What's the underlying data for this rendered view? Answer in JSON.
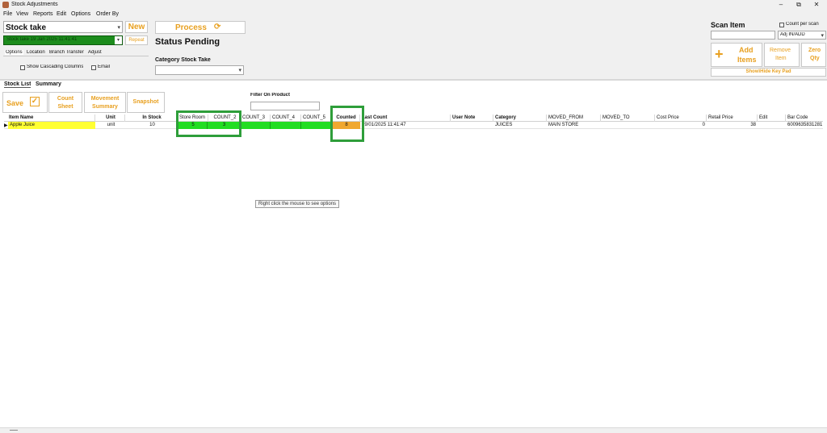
{
  "window": {
    "title": "Stock Adjustments",
    "controls": {
      "minimize": "–",
      "restore": "⧉",
      "close": "✕"
    }
  },
  "menu": [
    "File",
    "View",
    "Reports",
    "Edit",
    "Options",
    "Order By"
  ],
  "toolbar": {
    "doc_type": "Stock take",
    "new_label": "New",
    "stock_take_selected": "Stock take 19 Jan 2025 11:41:41",
    "repeat_label": "Repeat",
    "tabs": [
      "Options",
      "Location",
      "Branch Transfer",
      "Adjust"
    ],
    "show_cascading_label": "Show Cascading Columns",
    "email_label": "Email",
    "process_label": "Process",
    "status_text": "Status Pending",
    "category_label": "Category Stock Take",
    "category_value": ""
  },
  "scan": {
    "title": "Scan Item",
    "count_per_scan_label": "Count per scan",
    "mode_value": "Adj IN/ADD",
    "add_items_label": "Add Items",
    "add_line1": "Add",
    "add_line2": "Items",
    "remove_line1": "Remove",
    "remove_line2": "Item",
    "zero_line1": "Zero",
    "zero_line2": "Qty",
    "keypad_label": "Show\\Hide Key Pad"
  },
  "list_tabs": [
    "Stock List",
    "Summary"
  ],
  "actions": {
    "save_label": "Save",
    "count_line1": "Count",
    "count_line2": "Sheet",
    "movement_line1": "Movement",
    "movement_line2": "Summary",
    "snapshot_label": "Snapshot",
    "filter_label": "Filter On Product",
    "filter_value": ""
  },
  "grid": {
    "columns": [
      "Item Name",
      "Unit",
      "In Stock",
      "Store Room",
      "COUNT_2",
      "COUNT_3",
      "COUNT_4",
      "COUNT_5",
      "Counted",
      "Last Count",
      "User Note",
      "Category",
      "MOVED_FROM",
      "MOVED_TO",
      "Cost Price",
      "Retail Price",
      "Edit",
      "Bar Code"
    ],
    "rows": [
      {
        "item_name": "Apple Juice",
        "unit": "unit",
        "in_stock": "10",
        "store_room": "5",
        "count_2": "3",
        "count_3": "",
        "count_4": "",
        "count_5": "",
        "counted": "8",
        "last_count": "19/01/2025 11:41:47",
        "user_note": "",
        "category": "JUICES",
        "moved_from": "MAIN STORE",
        "moved_to": "",
        "cost_price": "0",
        "retail_price": "38",
        "edit": "",
        "bar_code": "6009635831281"
      }
    ]
  },
  "tooltip": "Right click the mouse to see options",
  "colors": {
    "accent_orange": "#e8a020",
    "count_green": "#22dd22",
    "item_yellow": "#ffff33",
    "counted_orange": "#f0a830",
    "highlight_box": "#2e9e3a"
  },
  "icons": {
    "app": "app-icon",
    "refresh": "refresh-icon",
    "check": "checkbox-check-icon",
    "plus": "plus-icon",
    "row_pointer": "row-pointer-icon"
  }
}
